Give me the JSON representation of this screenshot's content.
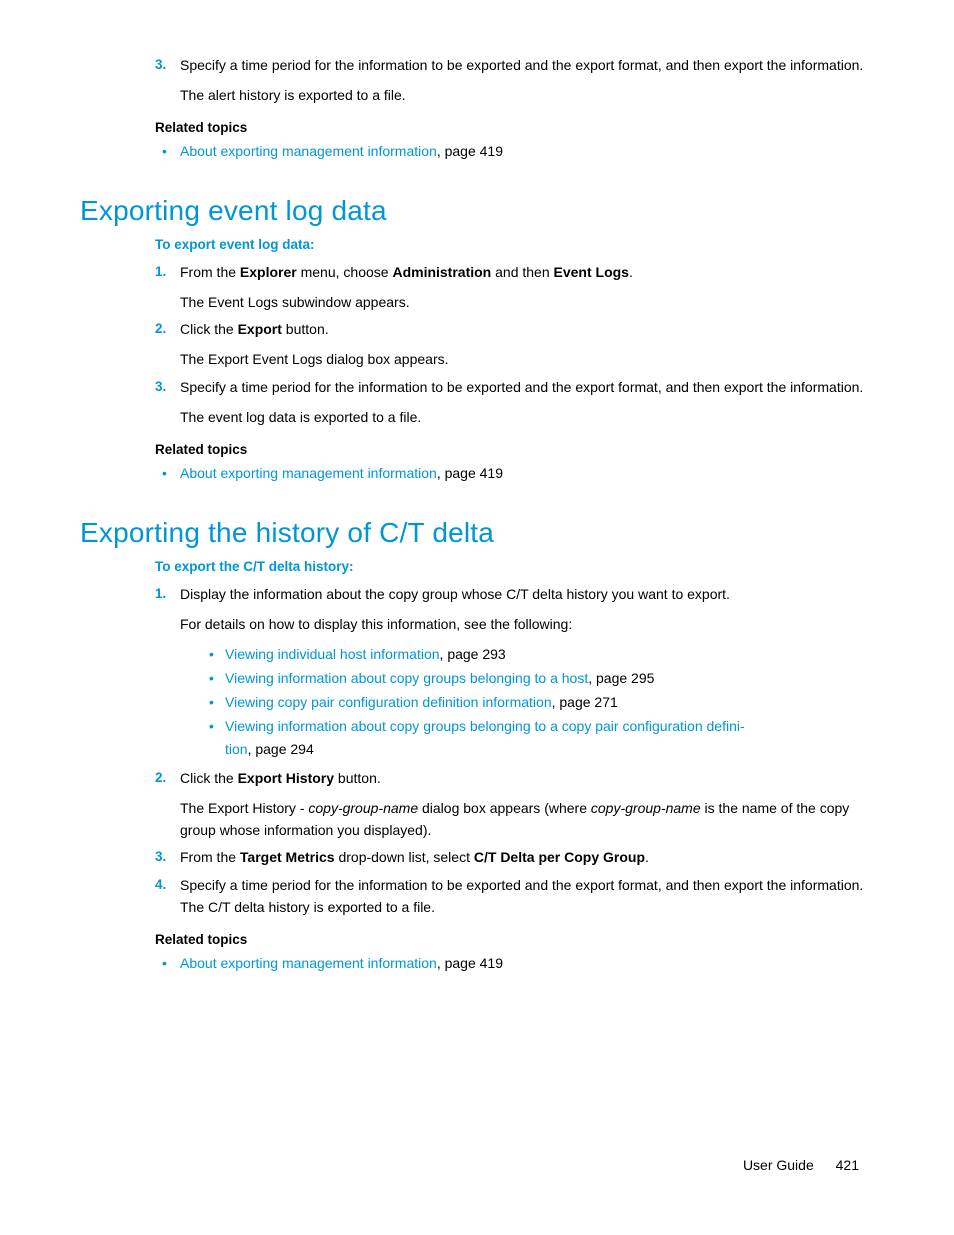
{
  "top": {
    "step3a": "Specify a time period for the information to be exported and the export format, and then export the information.",
    "step3b": "The alert history is exported to a file.",
    "related_heading": "Related topics",
    "rel_link": "About exporting management information",
    "rel_page": ", page 419"
  },
  "sec1": {
    "title": "Exporting event log data",
    "intro": "To export event log data:",
    "s1_pre": "From the ",
    "s1_b1": "Explorer",
    "s1_mid1": " menu, choose ",
    "s1_b2": "Administration",
    "s1_mid2": " and then ",
    "s1_b3": "Event Logs",
    "s1_end": ".",
    "s1_note": "The Event Logs subwindow appears.",
    "s2_pre": "Click the ",
    "s2_b": "Export",
    "s2_end": " button.",
    "s2_note": "The Export Event Logs dialog box appears.",
    "s3a": "Specify a time period for the information to be exported and the export format, and then export the information.",
    "s3b": "The event log data is exported to a file.",
    "related_heading": "Related topics",
    "rel_link": "About exporting management information",
    "rel_page": ", page 419"
  },
  "sec2": {
    "title": "Exporting the history of C/T delta",
    "intro": "To export the C/T delta history:",
    "s1a": "Display the information about the copy group whose C/T delta history you want to export.",
    "s1b": "For details on how to display this information, see the following:",
    "link1": "Viewing individual host information",
    "link1_pg": ", page 293",
    "link2": "Viewing information about copy groups belonging to a host",
    "link2_pg": ", page 295",
    "link3": "Viewing copy pair configuration definition information",
    "link3_pg": ", page 271",
    "link4a": "Viewing information about copy groups belonging to a copy pair configuration defini-",
    "link4b": "tion",
    "link4_pg": ", page 294",
    "s2_pre": "Click the ",
    "s2_b": "Export History",
    "s2_end": " button.",
    "s2n_pre": "The Export History - ",
    "s2n_i1": "copy-group-name",
    "s2n_mid": " dialog box appears (where ",
    "s2n_i2": "copy-group-name",
    "s2n_end": " is the name of the copy group whose information you displayed).",
    "s3_pre": "From the ",
    "s3_b1": "Target Metrics",
    "s3_mid": " drop-down list, select ",
    "s3_b2": "C/T Delta per Copy Group",
    "s3_end": ".",
    "s4": "Specify a time period for the information to be exported and the export format, and then export the information. The C/T delta history is exported to a file.",
    "related_heading": "Related topics",
    "rel_link": "About exporting management information",
    "rel_page": ", page 419"
  },
  "footer": {
    "label": "User Guide",
    "page": "421"
  }
}
